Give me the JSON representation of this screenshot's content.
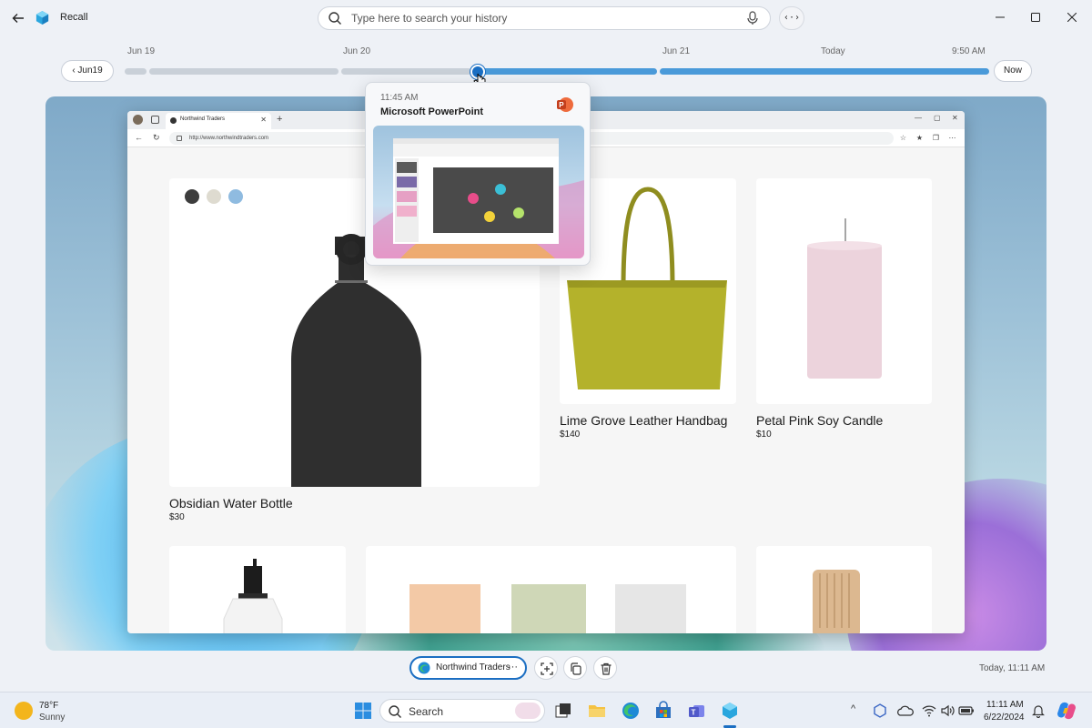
{
  "app": {
    "title": "Recall",
    "search_placeholder": "Type here to search your history",
    "code_button_label": "‹·›"
  },
  "timeline": {
    "labels": [
      "Jun 19",
      "Jun 20",
      "Jun 21",
      "Today",
      "9:50 AM"
    ],
    "prev_button": "Jun19",
    "now_button": "Now",
    "position_fraction": 0.42
  },
  "popup": {
    "time": "11:45 AM",
    "app_name": "Microsoft PowerPoint"
  },
  "browser": {
    "tab_title": "Northwind Traders",
    "url": "http://www.northwindtraders.com"
  },
  "products": [
    {
      "name": "Obsidian  Water Bottle",
      "price": "$30"
    },
    {
      "name": "Lime Grove Leather Handbag",
      "price": "$140"
    },
    {
      "name": "Petal Pink Soy Candle",
      "price": "$10"
    }
  ],
  "swatch_colors": [
    "#3d3d3d",
    "#dedbd0",
    "#8fbbe0"
  ],
  "actions": {
    "app_pill_label": "Northwind Traders",
    "more": "···",
    "timestamp": "Today, 11:11 AM"
  },
  "taskbar": {
    "weather_temp": "78°F",
    "weather_cond": "Sunny",
    "search_label": "Search",
    "time": "11:11 AM",
    "date": "6/22/2024"
  },
  "colors": {
    "accent": "#1b6ec2",
    "track_active": "#4a9ad9",
    "track_inactive": "#c9d0d8"
  }
}
